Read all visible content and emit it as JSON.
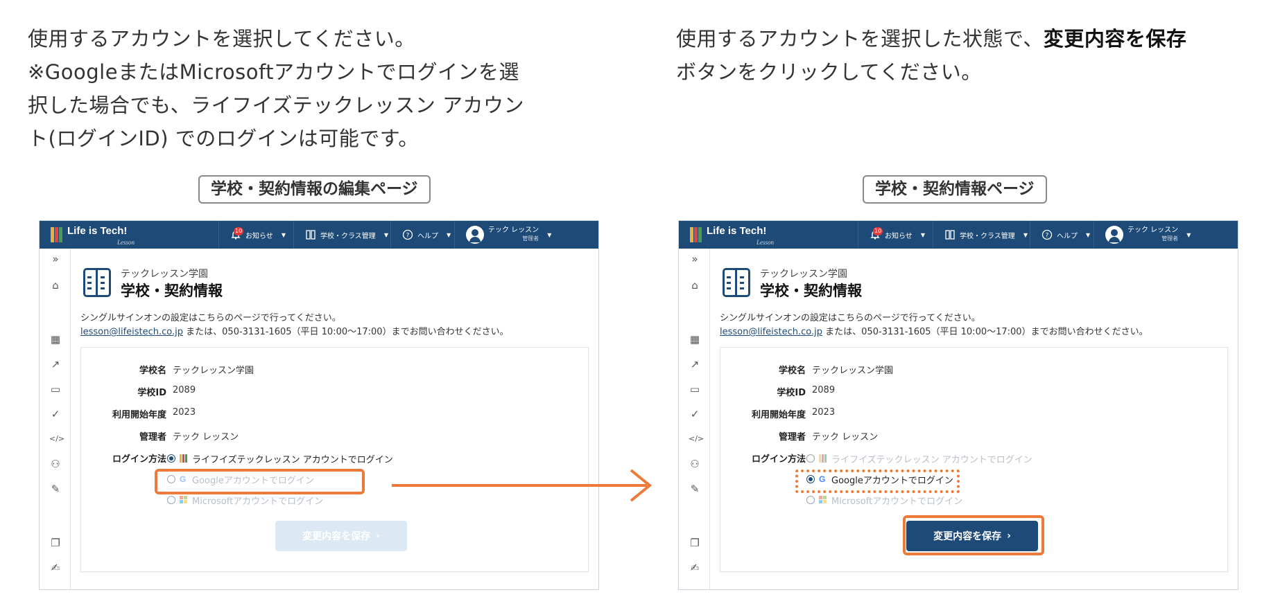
{
  "instructions": {
    "left": [
      "使用するアカウントを選択してください。",
      "※GoogleまたはMicrosoftアカウントでログインを選",
      "択した場合でも、ライフイズテックレッスン アカウン",
      "ト(ログインID) でのログインは可能です。"
    ],
    "right_prefix": "使用するアカウントを選択した状態で、",
    "right_bold": "変更内容を保存",
    "right_suffix": "ボタンをクリックしてください。"
  },
  "labels": {
    "left": "学校・契約情報の編集ページ",
    "right": "学校・契約情報ページ"
  },
  "colors": {
    "navy": "#1e4a77",
    "highlight": "#ee7a3a",
    "badge": "#e23b3b"
  },
  "app": {
    "brand": "Life is Tech!",
    "brand_sub": "Lesson",
    "nav": {
      "news": "お知らせ",
      "news_badge": "10",
      "school": "学校・クラス管理",
      "help": "ヘルプ",
      "user_name": "テック レッスン",
      "user_role": "管理者"
    },
    "school_small": "テックレッスン学園",
    "title": "学校・契約情報",
    "note1": "シングルサインオンの設定はこちらのページで行ってください。",
    "note2_link": "lesson@lifeistech.co.jp",
    "note2_rest": " または、050-3131-1605（平日 10:00〜17:00）までお問い合わせください。",
    "fields": [
      {
        "key": "学校名",
        "value": "テックレッスン学園"
      },
      {
        "key": "学校ID",
        "value": "2089"
      },
      {
        "key": "利用開始年度",
        "value": "2023"
      },
      {
        "key": "管理者",
        "value": "テック レッスン"
      }
    ],
    "login_label": "ログイン方法",
    "login_options": [
      "ライフイズテックレッスン アカウントでログイン",
      "Googleアカウントでログイン",
      "Microsoftアカウントでログイン"
    ],
    "save_label": "変更内容を保存",
    "left_selected": 0,
    "right_selected": 1
  }
}
